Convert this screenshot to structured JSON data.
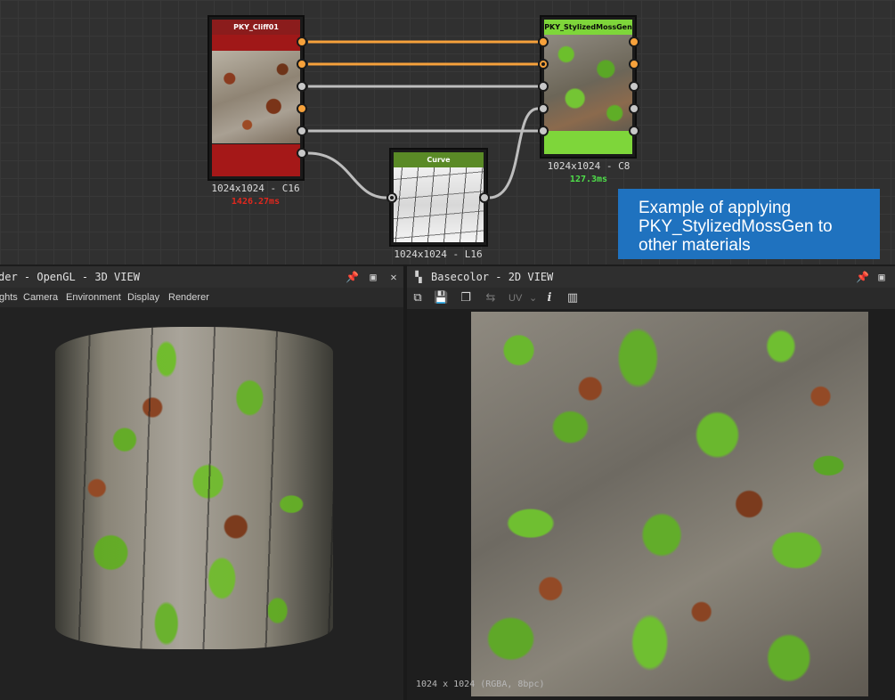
{
  "graph": {
    "nodes": {
      "cliff": {
        "title": "PKY_Cliff01",
        "info": "1024x1024 - C16",
        "time": "1426.27ms",
        "header_color": "#8b1c1c",
        "time_color": "#e0281e"
      },
      "moss": {
        "title": "PKY_StylizedMossGen",
        "info": "1024x1024 - C8",
        "time": "127.3ms",
        "header_color": "#7ed63a",
        "time_color": "#4fe04a"
      },
      "curve": {
        "title": "Curve",
        "info": "1024x1024 - L16",
        "header_color": "#5a8a26"
      }
    },
    "callout": {
      "line1": "Example of applying",
      "line2": "PKY_StylizedMossGen to",
      "line3": "other materials"
    },
    "wire_colors": {
      "color": "#f6a13b",
      "gray": "#bdbdbd"
    }
  },
  "view3d": {
    "title": "der - OpenGL - 3D VIEW",
    "menu": [
      "ghts",
      "Camera",
      "Environment",
      "Display",
      "Renderer"
    ],
    "icons": [
      "pin-icon",
      "maximize-icon",
      "close-icon"
    ]
  },
  "view2d": {
    "title": "Basecolor - 2D VIEW",
    "toolbar_uv_label": "UV",
    "status": "1024 x 1024 (RGBA, 8bpc)",
    "icons": [
      "pin-icon",
      "maximize-icon"
    ]
  }
}
